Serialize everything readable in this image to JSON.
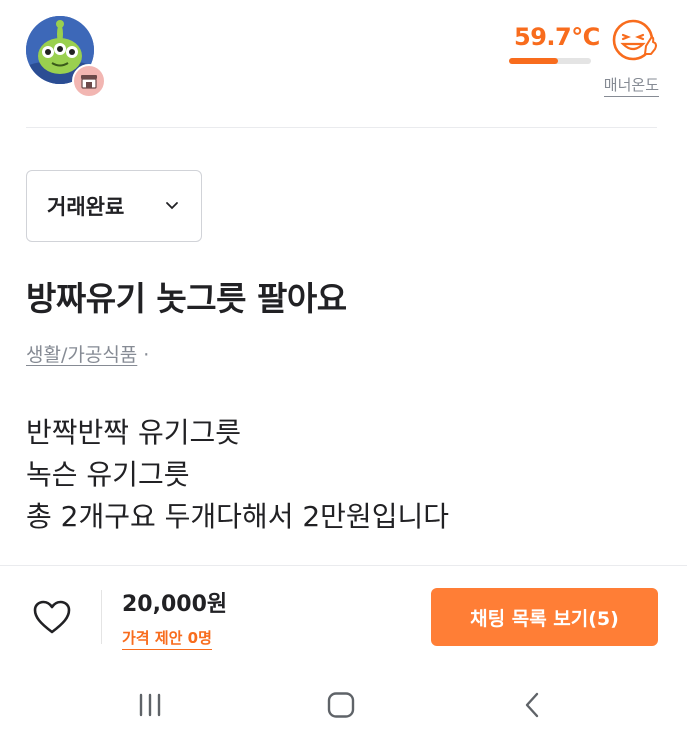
{
  "seller": {
    "avatar_icon": "alien-toy-avatar-icon",
    "badge_icon": "shop-badge-icon",
    "manner_temperature": "59.7℃",
    "manner_temperature_value": 59.7,
    "temperature_fraction": 0.6,
    "temperature_face_icon": "laughing-face-icon",
    "manner_label": "매너온도"
  },
  "listing": {
    "status": "거래완료",
    "title": "방짜유기 놋그릇 팔아요",
    "category": "생활/가공식품",
    "separator": "·",
    "description": [
      "반짝반짝 유기그릇",
      "녹슨 유기그릇",
      "총 2개구요 두개다해서 2만원입니다"
    ]
  },
  "bottom_bar": {
    "like_icon": "heart-outline-icon",
    "price": "20,000원",
    "price_offer": "가격 제안 0명",
    "chat_button": "채팅 목록 보기(5)"
  },
  "system_nav": {
    "recent_icon": "recent-apps-icon",
    "home_icon": "home-icon",
    "back_icon": "back-icon"
  },
  "colors": {
    "accent": "#ff7e36",
    "temperature": "#f86c1d",
    "muted_text": "#868b94",
    "main_text": "#212124"
  }
}
